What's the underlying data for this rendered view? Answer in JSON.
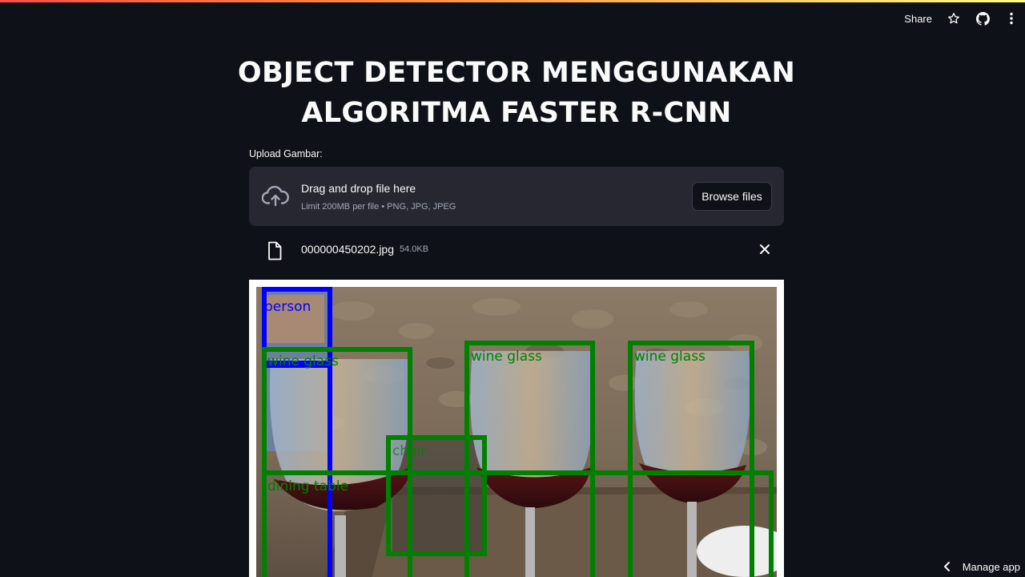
{
  "header": {
    "share_label": "Share",
    "star_icon": "star-icon",
    "github_icon": "github-icon",
    "menu_icon": "kebab-menu-icon"
  },
  "page": {
    "title_line1": "OBJECT DETECTOR MENGGUNAKAN",
    "title_line2": "ALGORITMA FASTER R-CNN"
  },
  "uploader": {
    "label": "Upload Gambar:",
    "drop_title": "Drag and drop file here",
    "drop_subtitle": "Limit 200MB per file • PNG, JPG, JPEG",
    "browse_label": "Browse files",
    "icon": "cloud-upload-icon"
  },
  "uploaded_file": {
    "name": "000000450202.jpg",
    "size": "54.0KB",
    "icon": "file-icon",
    "remove_icon": "close-icon"
  },
  "detections": [
    {
      "label": "person",
      "color": "#0000ff"
    },
    {
      "label": "wine glass",
      "color": "#008000"
    },
    {
      "label": "wine glass",
      "color": "#008000"
    },
    {
      "label": "wine glass",
      "color": "#008000"
    },
    {
      "label": "chair",
      "color": "#008000"
    },
    {
      "label": "dining table",
      "color": "#008000"
    }
  ],
  "footer": {
    "manage_label": "Manage app",
    "chevron_icon": "chevron-left-icon"
  },
  "colors": {
    "background": "#0e1117",
    "panel": "#262730",
    "box_person": "#0000ff",
    "box_other": "#008000"
  }
}
